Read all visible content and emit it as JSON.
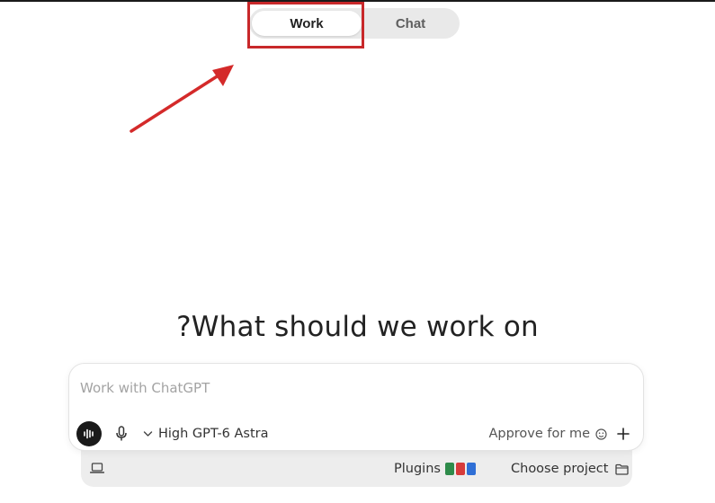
{
  "mode_toggle": {
    "work_label": "Work",
    "chat_label": "Chat",
    "active": "Work"
  },
  "annotation": {
    "highlight_color": "#c8282a",
    "arrow_color": "#d42a2a"
  },
  "heading": "?What should we work on",
  "composer": {
    "placeholder": "Work with ChatGPT",
    "value": "",
    "model_label": "High GPT-6 Astra",
    "approve_label": "Approve for me",
    "icons": {
      "voice": "voice-waveform-icon",
      "mic": "microphone-icon",
      "model": "chevron-down-icon",
      "approve": "smiley-icon",
      "add": "plus-icon"
    }
  },
  "footer": {
    "plugins_label": "Plugins",
    "plugin_icons": [
      {
        "name": "spreadsheet-plugin-icon",
        "color": "#2e8b4a"
      },
      {
        "name": "pdf-plugin-icon",
        "color": "#d63b3b"
      },
      {
        "name": "document-plugin-icon",
        "color": "#2f6fd6"
      }
    ],
    "project_label": "Choose project",
    "icons": {
      "laptop": "laptop-icon",
      "folder": "folder-icon"
    }
  }
}
